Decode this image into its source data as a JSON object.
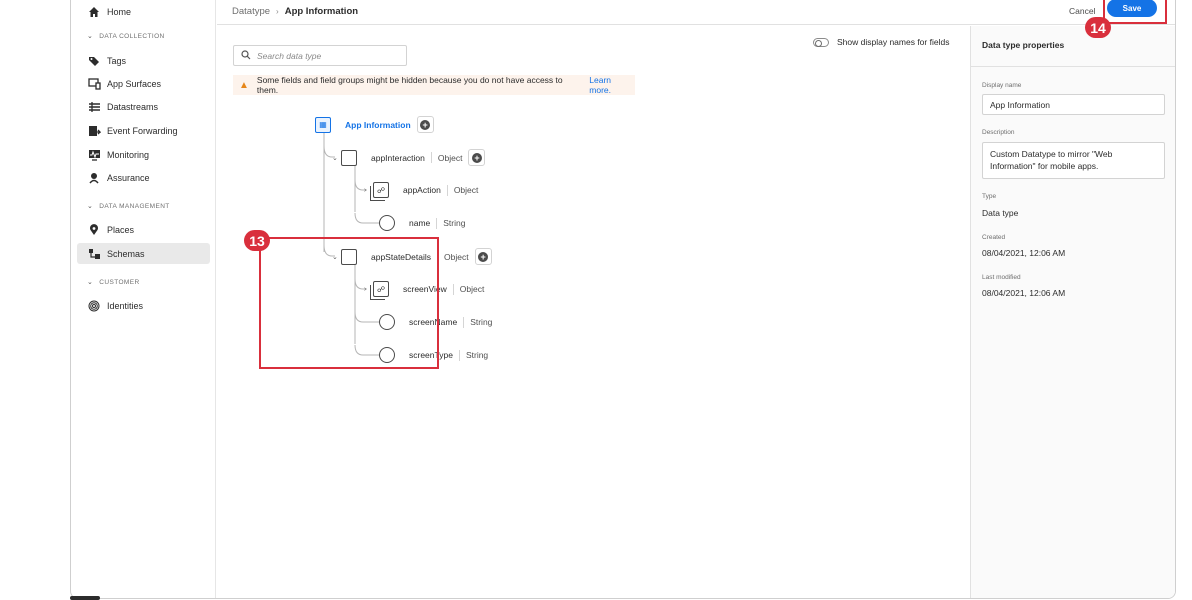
{
  "sidebar": {
    "items": [
      {
        "label": "Home",
        "icon": "home-icon"
      },
      {
        "label": "Tags",
        "icon": "tags-icon"
      },
      {
        "label": "App Surfaces",
        "icon": "app-surfaces-icon"
      },
      {
        "label": "Datastreams",
        "icon": "datastreams-icon"
      },
      {
        "label": "Event Forwarding",
        "icon": "event-forwarding-icon"
      },
      {
        "label": "Monitoring",
        "icon": "monitoring-icon"
      },
      {
        "label": "Assurance",
        "icon": "assurance-icon"
      },
      {
        "label": "Places",
        "icon": "places-icon"
      },
      {
        "label": "Schemas",
        "icon": "schemas-icon"
      },
      {
        "label": "Identities",
        "icon": "identities-icon"
      }
    ],
    "headings": [
      "DATA COLLECTION",
      "DATA MANAGEMENT",
      "CUSTOMER"
    ]
  },
  "header": {
    "breadcrumb_parent": "Datatype",
    "breadcrumb_current": "App Information",
    "cancel_label": "Cancel",
    "save_label": "Save"
  },
  "callouts": {
    "tree": "13",
    "save": "14"
  },
  "search": {
    "placeholder": "Search data type"
  },
  "toggle": {
    "label": "Show display names for fields",
    "on": false
  },
  "alert": {
    "text": "Some fields and field groups might be hidden because you do not have access to them.",
    "link": "Learn more."
  },
  "tree": {
    "root": "App Information",
    "nodes": [
      {
        "name": "appInteraction",
        "type": "Object"
      },
      {
        "name": "appAction",
        "type": "Object"
      },
      {
        "name": "name",
        "type": "String"
      },
      {
        "name": "appStateDetails",
        "type": "Object"
      },
      {
        "name": "screenView",
        "type": "Object"
      },
      {
        "name": "screenName",
        "type": "String"
      },
      {
        "name": "screenType",
        "type": "String"
      }
    ]
  },
  "properties": {
    "title": "Data type properties",
    "display_name_label": "Display name",
    "display_name": "App Information",
    "description_label": "Description",
    "description": "Custom Datatype to mirror \"Web Information\" for mobile apps.",
    "type_label": "Type",
    "type": "Data type",
    "created_label": "Created",
    "created": "08/04/2021, 12:06 AM",
    "modified_label": "Last modified",
    "modified": "08/04/2021, 12:06 AM"
  },
  "colors": {
    "accent": "#1473e6",
    "callout": "#d92f3c",
    "warning": "#e68619"
  }
}
